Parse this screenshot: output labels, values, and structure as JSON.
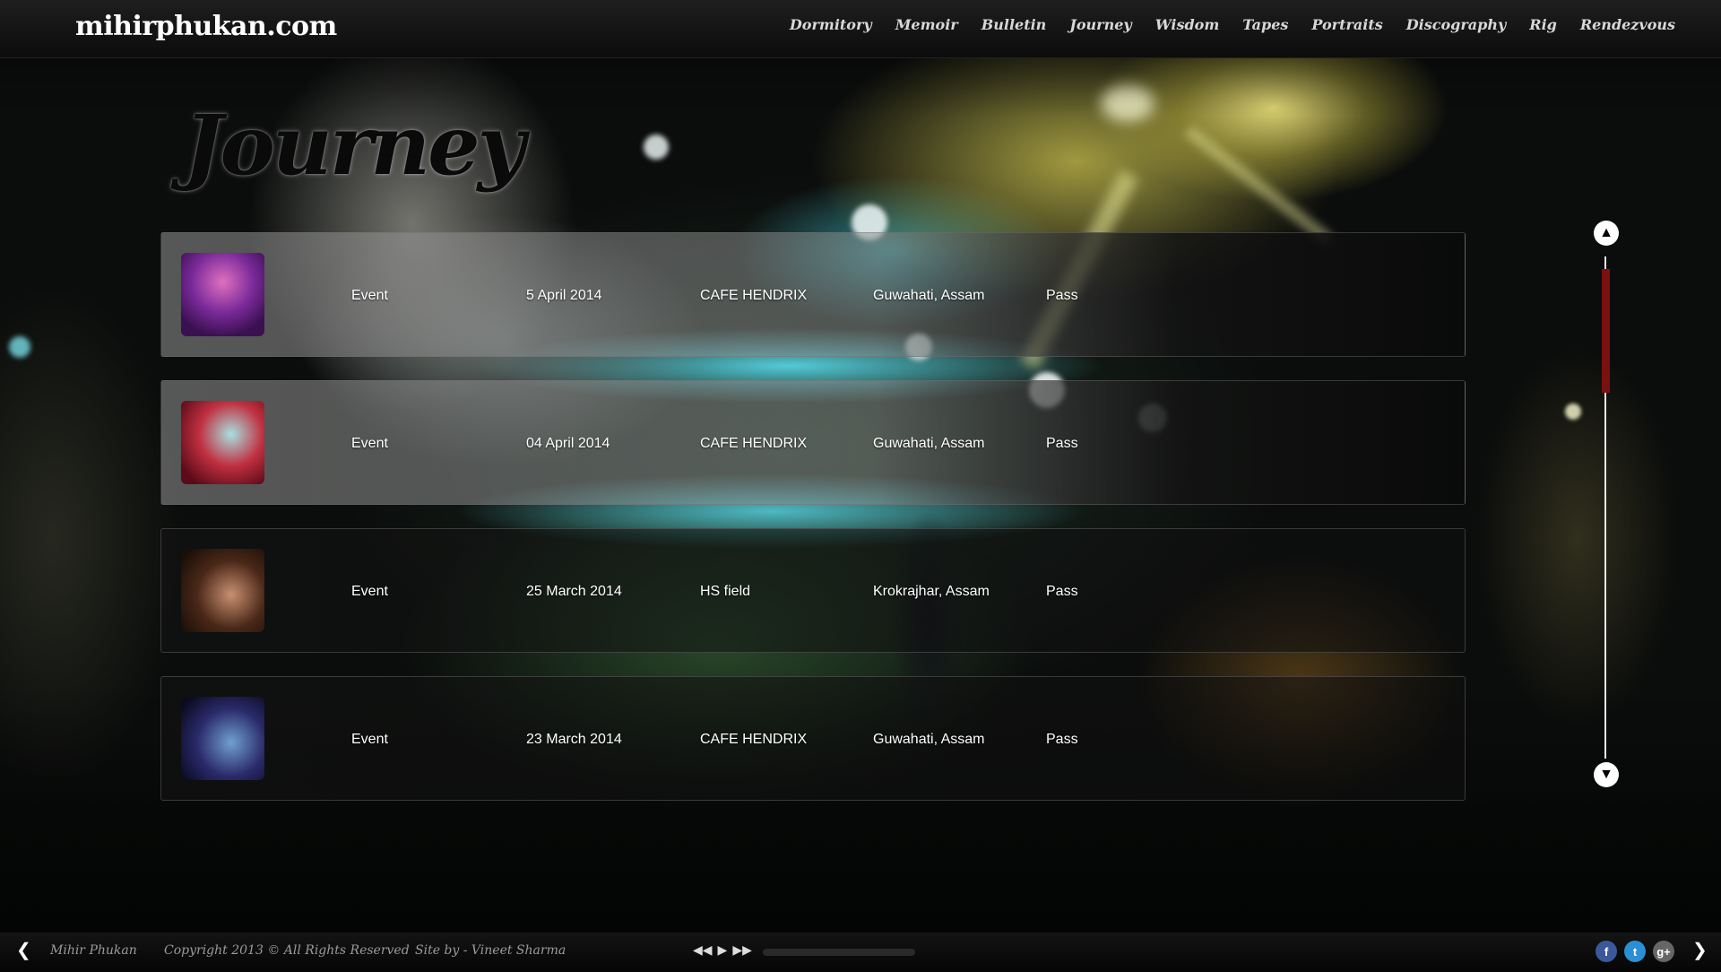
{
  "site": {
    "logo": "mihirphukan.com",
    "nav": [
      "Dormitory",
      "Memoir",
      "Bulletin",
      "Journey",
      "Wisdom",
      "Tapes",
      "Portraits",
      "Discography",
      "Rig",
      "Rendezvous"
    ]
  },
  "page": {
    "title": "Journey"
  },
  "events": [
    {
      "type": "Event",
      "date": "5 April 2014",
      "venue": "CAFE HENDRIX",
      "location": "Guwahati, Assam",
      "entry": "Pass"
    },
    {
      "type": "Event",
      "date": "04 April 2014",
      "venue": "CAFE HENDRIX",
      "location": "Guwahati, Assam",
      "entry": "Pass"
    },
    {
      "type": "Event",
      "date": "25 March 2014",
      "venue": "HS field",
      "location": "Krokrajhar, Assam",
      "entry": "Pass"
    },
    {
      "type": "Event",
      "date": "23 March 2014",
      "venue": "CAFE HENDRIX",
      "location": "Guwahati, Assam",
      "entry": "Pass"
    }
  ],
  "footer": {
    "name": "Mihir Phukan",
    "copyright": "Copyright 2013 © All Rights Reserved",
    "credit": "Site by - Vineet Sharma",
    "player": {
      "rewind": "◀◀",
      "play": "▶",
      "forward": "▶▶",
      "progress": 0.0
    },
    "social": [
      "f",
      "t",
      "g+"
    ]
  },
  "colors": {
    "scroll_thumb": "#7a1010",
    "facebook": "#3b5998",
    "twitter": "#2b8fd6",
    "google": "#666666"
  },
  "icons": {
    "scroll_up": "up-arrow-icon",
    "scroll_down": "down-arrow-icon",
    "prev": "chevron-left-icon",
    "next": "chevron-right-icon"
  }
}
